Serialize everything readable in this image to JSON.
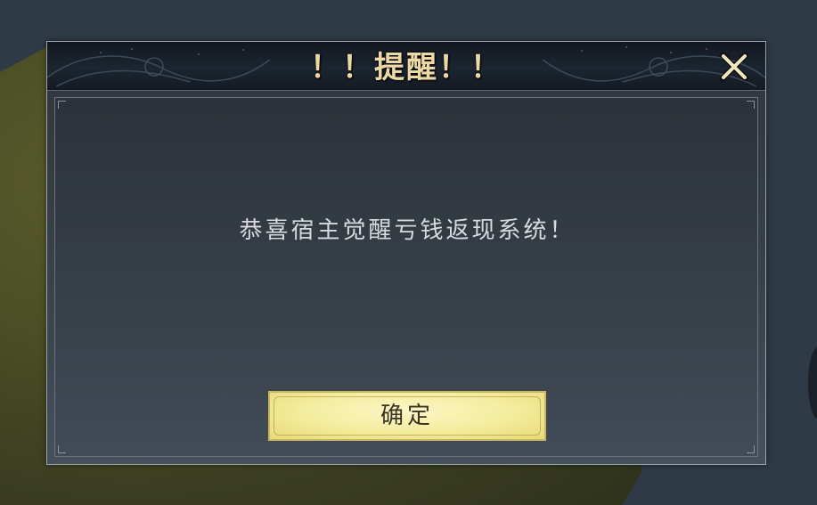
{
  "dialog": {
    "title": "！！提醒！！",
    "message": "恭喜宿主觉醒亏钱返现系统！",
    "confirm_label": "确定",
    "close_icon": "close-icon"
  },
  "colors": {
    "title_text": "#ecd9a6",
    "button_fill": "#f4ec9c",
    "panel_bg": "#384049"
  }
}
